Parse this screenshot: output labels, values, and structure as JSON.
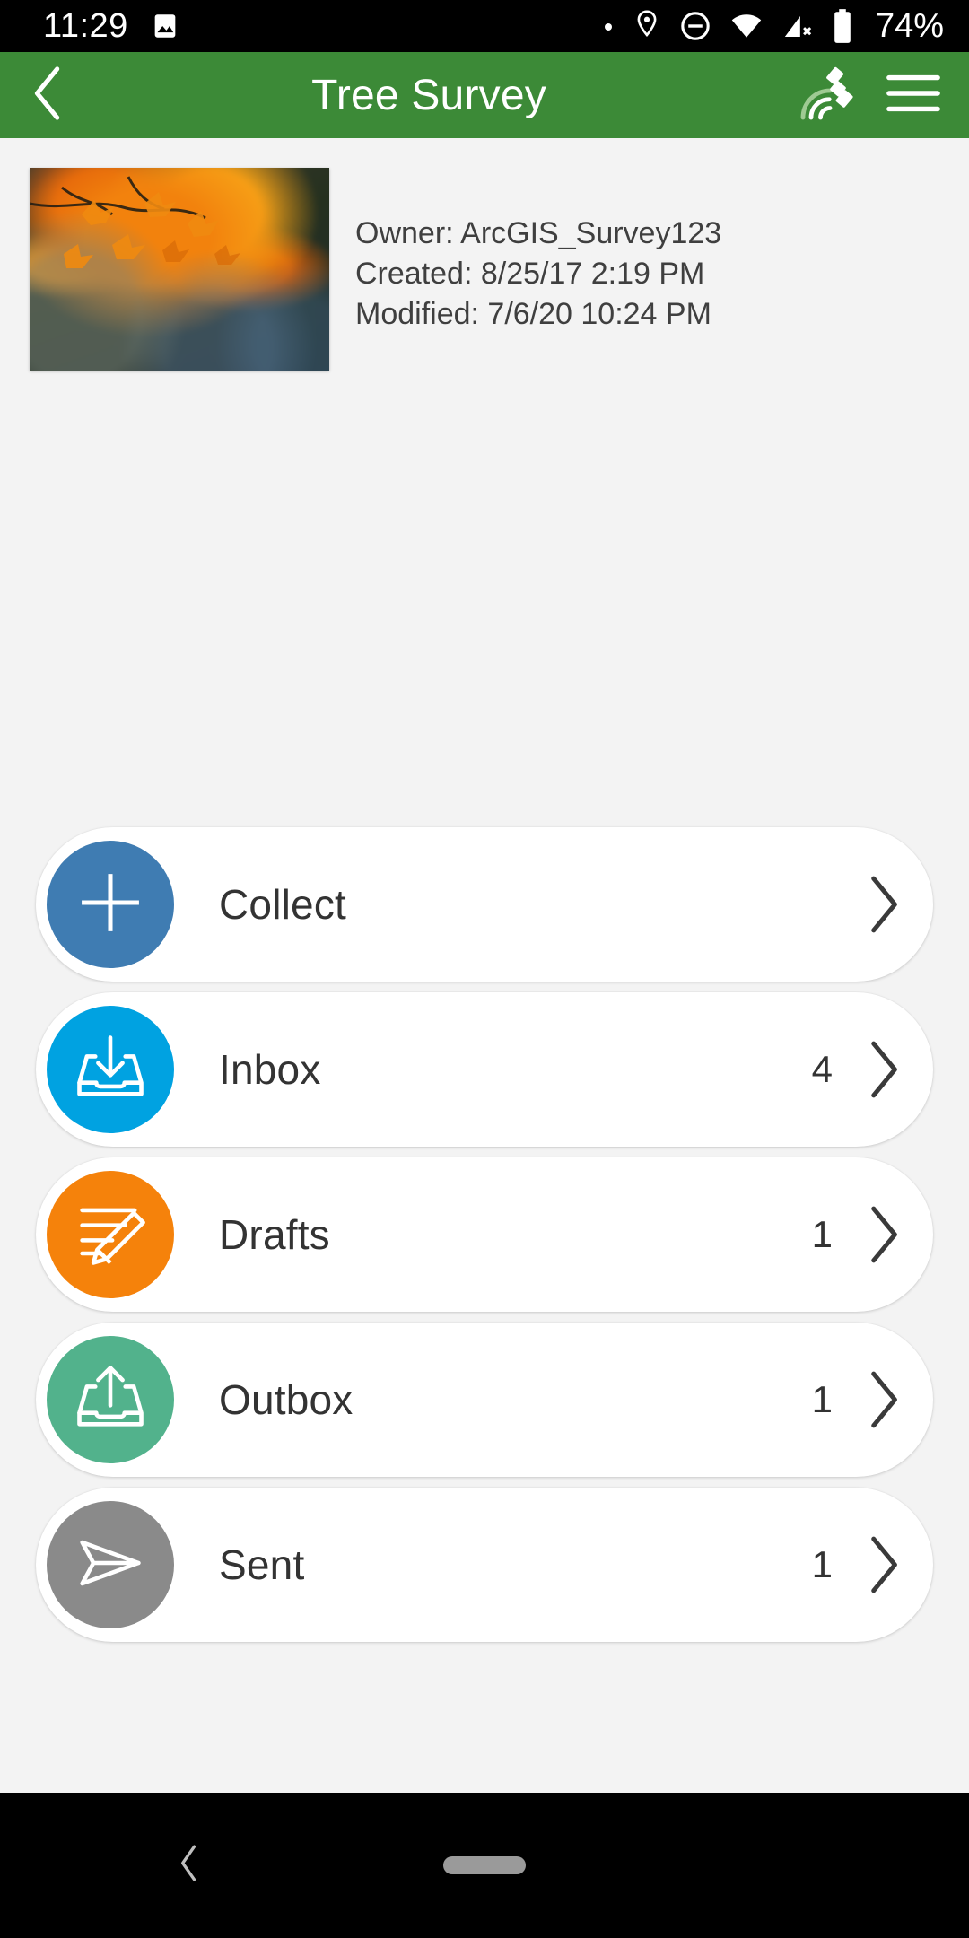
{
  "status_bar": {
    "time": "11:29",
    "battery_percent": "74%",
    "icons": [
      "image-icon",
      "dot-icon",
      "location-pin-icon",
      "do-not-disturb-icon",
      "wifi-icon",
      "cellular-off-icon",
      "battery-icon"
    ]
  },
  "app_bar": {
    "title": "Tree Survey",
    "back_icon": "chevron-left-icon",
    "gps_icon": "satellite-icon",
    "menu_icon": "hamburger-menu-icon"
  },
  "survey": {
    "thumbnail_alt": "autumn-maple-leaves-thumbnail",
    "owner": "Owner: ArcGIS_Survey123",
    "created": "Created: 8/25/17 2:19 PM",
    "modified": "Modified: 7/6/20 10:24 PM"
  },
  "colors": {
    "app_bar_green": "#3c8a37",
    "collect_blue": "#3f7cb2",
    "inbox_cyan": "#00a2e1",
    "drafts_orange": "#f5820b",
    "outbox_green": "#52b28c",
    "sent_gray": "#8a8a8a",
    "page_background": "#f3f3f3"
  },
  "list": [
    {
      "label": "Collect",
      "count": "",
      "icon": "plus-icon",
      "color": "#3f7cb2"
    },
    {
      "label": "Inbox",
      "count": "4",
      "icon": "tray-download-icon",
      "color": "#00a2e1"
    },
    {
      "label": "Drafts",
      "count": "1",
      "icon": "pencil-lines-icon",
      "color": "#f5820b"
    },
    {
      "label": "Outbox",
      "count": "1",
      "icon": "tray-upload-icon",
      "color": "#52b28c"
    },
    {
      "label": "Sent",
      "count": "1",
      "icon": "paper-plane-icon",
      "color": "#8a8a8a"
    }
  ],
  "nav_bar": {
    "back_icon": "nav-back-icon",
    "home_pill": "nav-home-pill"
  }
}
